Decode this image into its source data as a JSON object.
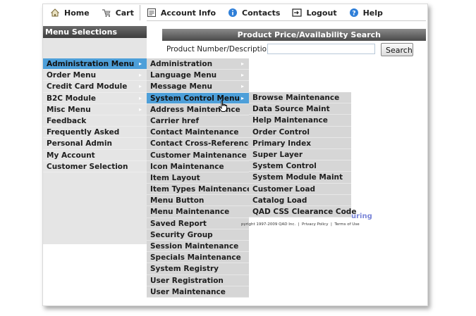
{
  "nav": [
    {
      "label": "Home",
      "icon": "home-icon"
    },
    {
      "label": "Cart",
      "icon": "cart-icon"
    },
    {
      "label": "Account Info",
      "icon": "account-icon"
    },
    {
      "label": "Contacts",
      "icon": "info-icon"
    },
    {
      "label": "Logout",
      "icon": "logout-icon"
    },
    {
      "label": "Help",
      "icon": "help-icon"
    }
  ],
  "sidebar": {
    "title": "Menu Selections",
    "items": [
      "Administration Menu",
      "Order Menu",
      "Credit Card Module",
      "B2C Module",
      "Misc Menu",
      "Feedback",
      "Frequently Asked",
      "Personal Admin",
      "My Account",
      "Customer Selection"
    ],
    "active_index": 0
  },
  "admin_submenu": {
    "items": [
      "Administration",
      "Language Menu",
      "Message Menu",
      "System Control Menu",
      "Address Maintenance",
      "Carrier href",
      "Contact Maintenance",
      "Contact Cross-Reference",
      "Customer Maintenance",
      "Icon Maintenance",
      "Item Layout",
      "Item Types Maintenance",
      "Menu Button",
      "Menu Maintenance",
      "Saved Report",
      "Security Group",
      "Session Maintenance",
      "Specials Maintenance",
      "System Registry",
      "User Registration",
      "User Maintenance"
    ],
    "active_index": 3
  },
  "system_control_submenu": {
    "items": [
      "Browse Maintenance",
      "Data Source Maint",
      "Help Maintenance",
      "Order Control",
      "Primary Index",
      "Super Layer",
      "System Control",
      "System Module Maint",
      "Customer Load",
      "Catalog Load",
      "QAD CSS Clearance Code"
    ]
  },
  "search": {
    "title": "Product Price/Availability Search",
    "label": "Product Number/Description:",
    "value": "",
    "button": "Search"
  },
  "footer": {
    "brand_fragment": "uring",
    "copyright": "pyright 1997-2009 QAD Inc.",
    "privacy": "Privacy Policy",
    "terms": "Terms of Use"
  },
  "colors": {
    "highlight": "#4d9fd9",
    "menu_bg": "#d6d6d6",
    "panel_bg": "#e5e5e5"
  }
}
